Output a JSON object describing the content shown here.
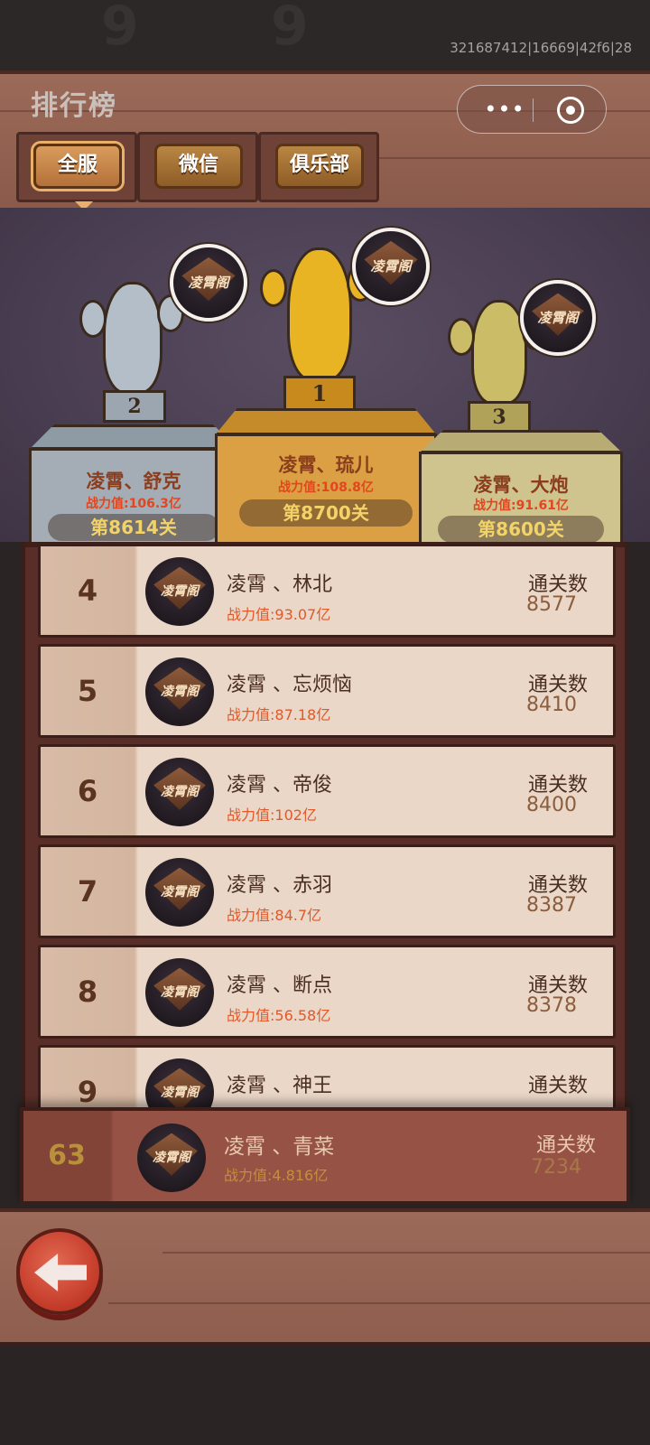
{
  "build_id": "321687412|16669|42f6|28",
  "page_title": "排行榜",
  "tabs": [
    {
      "label": "全服",
      "active": true
    },
    {
      "label": "微信",
      "active": false
    },
    {
      "label": "俱乐部",
      "active": false
    }
  ],
  "avatar_logo_text": "凌霄阁",
  "podium": {
    "second": {
      "rank": "2",
      "name": "凌霄、舒克",
      "power": "战力值:106.3亿",
      "level": "第8614关"
    },
    "first": {
      "rank": "1",
      "name": "凌霄、琉儿",
      "power": "战力值:108.8亿",
      "level": "第8700关"
    },
    "third": {
      "rank": "3",
      "name": "凌霄、大炮",
      "power": "战力值:91.61亿",
      "level": "第8600关"
    }
  },
  "list": [
    {
      "rank": "4",
      "name": "凌霄 、林北",
      "power": "战力值:93.07亿",
      "label": "通关数",
      "value": "8577"
    },
    {
      "rank": "5",
      "name": "凌霄 、忘烦恼",
      "power": "战力值:87.18亿",
      "label": "通关数",
      "value": "8410"
    },
    {
      "rank": "6",
      "name": "凌霄 、帝俊",
      "power": "战力值:102亿",
      "label": "通关数",
      "value": "8400"
    },
    {
      "rank": "7",
      "name": "凌霄 、赤羽",
      "power": "战力值:84.7亿",
      "label": "通关数",
      "value": "8387"
    },
    {
      "rank": "8",
      "name": "凌霄 、断点",
      "power": "战力值:56.58亿",
      "label": "通关数",
      "value": "8378"
    },
    {
      "rank": "9",
      "name": "凌霄 、神王",
      "power": "",
      "label": "通关数",
      "value": ""
    }
  ],
  "my_rank": {
    "rank": "63",
    "name": "凌霄 、青菜",
    "power": "战力值:4.816亿",
    "label": "通关数",
    "value": "7234"
  },
  "colors": {
    "wood": "#9c6a58",
    "gold": "#dba044",
    "silver": "#a4adb5",
    "bronze": "#cfc38e",
    "power_orange": "#e0592a"
  }
}
